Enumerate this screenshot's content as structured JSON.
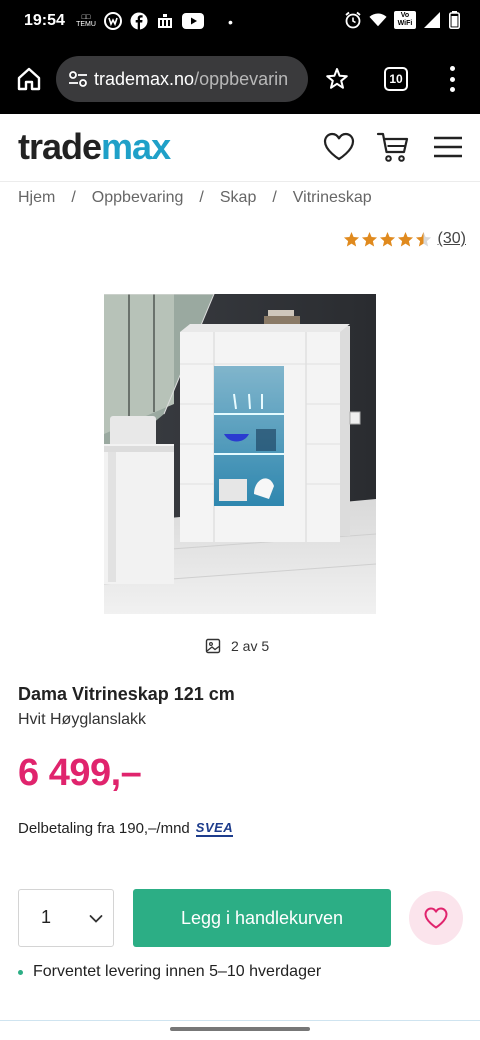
{
  "status_bar": {
    "time": "19:54",
    "dot": "•",
    "left_icons": [
      "temu-icon",
      "w-app-icon",
      "facebook-icon",
      "news-icon",
      "youtube-icon"
    ],
    "right_icons": [
      "alarm-icon",
      "wifi-icon",
      "vowifi-icon",
      "signal-icon",
      "battery-icon"
    ],
    "temu_label": "TEMU",
    "vowifi_label": "Vo WiFi"
  },
  "browser": {
    "url_domain": "trademax.no",
    "url_path": "/oppbevarin",
    "tab_count": "10"
  },
  "header": {
    "logo_part1": "trade",
    "logo_part2": "max"
  },
  "breadcrumb": {
    "items": [
      "Hjem",
      "Oppbevaring",
      "Skap",
      "Vitrineskap"
    ],
    "separator": "/"
  },
  "rating": {
    "stars": 4.5,
    "count_label": "(30)",
    "star_color": "#e08a1e"
  },
  "gallery": {
    "counter": "2 av 5"
  },
  "product": {
    "name": "Dama Vitrineskap 121 cm",
    "variant": "Hvit Høyglanslakk",
    "price": "6 499,–",
    "installment_text": "Delbetaling fra 190,–/mnd",
    "installment_provider": "SVEA"
  },
  "cart": {
    "quantity": "1",
    "add_label": "Legg i handlekurven"
  },
  "delivery": {
    "text": "Forventet levering innen 5–10 hverdager"
  },
  "colors": {
    "brand_blue": "#1fa0c8",
    "price_pink": "#e0246d",
    "cta_green": "#2cae85",
    "wishlist_bg": "#fbe4ec"
  }
}
